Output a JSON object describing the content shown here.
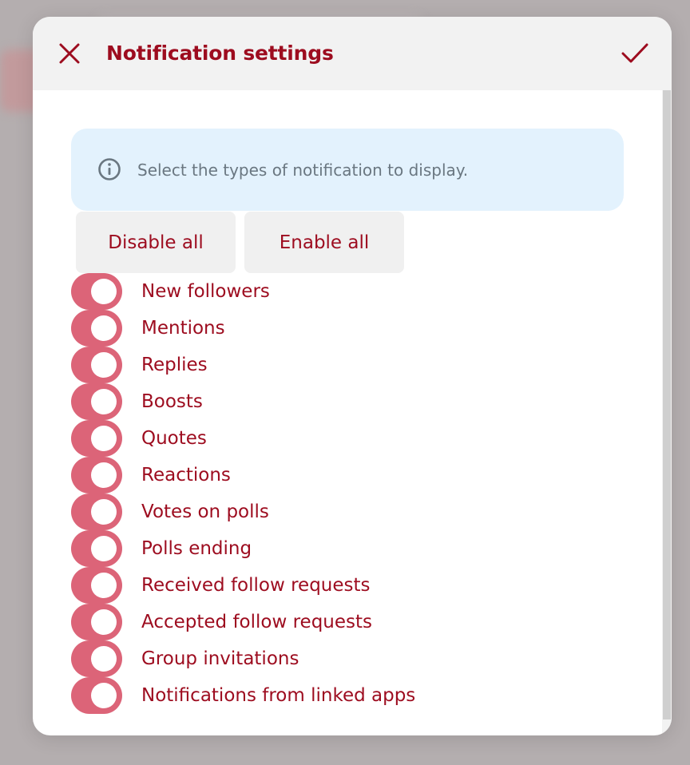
{
  "dialog": {
    "title": "Notification settings",
    "close_icon": "close-icon",
    "confirm_icon": "checkmark-icon"
  },
  "info": {
    "icon": "info-icon",
    "text": "Select the types of notification to display."
  },
  "actions": {
    "disable_all": "Disable all",
    "enable_all": "Enable all"
  },
  "notification_types": [
    {
      "label": "New followers",
      "enabled": true
    },
    {
      "label": "Mentions",
      "enabled": true
    },
    {
      "label": "Replies",
      "enabled": true
    },
    {
      "label": "Boosts",
      "enabled": true
    },
    {
      "label": "Quotes",
      "enabled": true
    },
    {
      "label": "Reactions",
      "enabled": true
    },
    {
      "label": "Votes on polls",
      "enabled": true
    },
    {
      "label": "Polls ending",
      "enabled": true
    },
    {
      "label": "Received follow requests",
      "enabled": true
    },
    {
      "label": "Accepted follow requests",
      "enabled": true
    },
    {
      "label": "Group invitations",
      "enabled": true
    },
    {
      "label": "Notifications from linked apps",
      "enabled": true
    }
  ],
  "colors": {
    "accent": "#9d0c1f",
    "toggle_on": "#dc6478",
    "info_bg": "#e3f2fd",
    "header_bg": "#f2f2f2",
    "backdrop": "#b4aeaf"
  }
}
